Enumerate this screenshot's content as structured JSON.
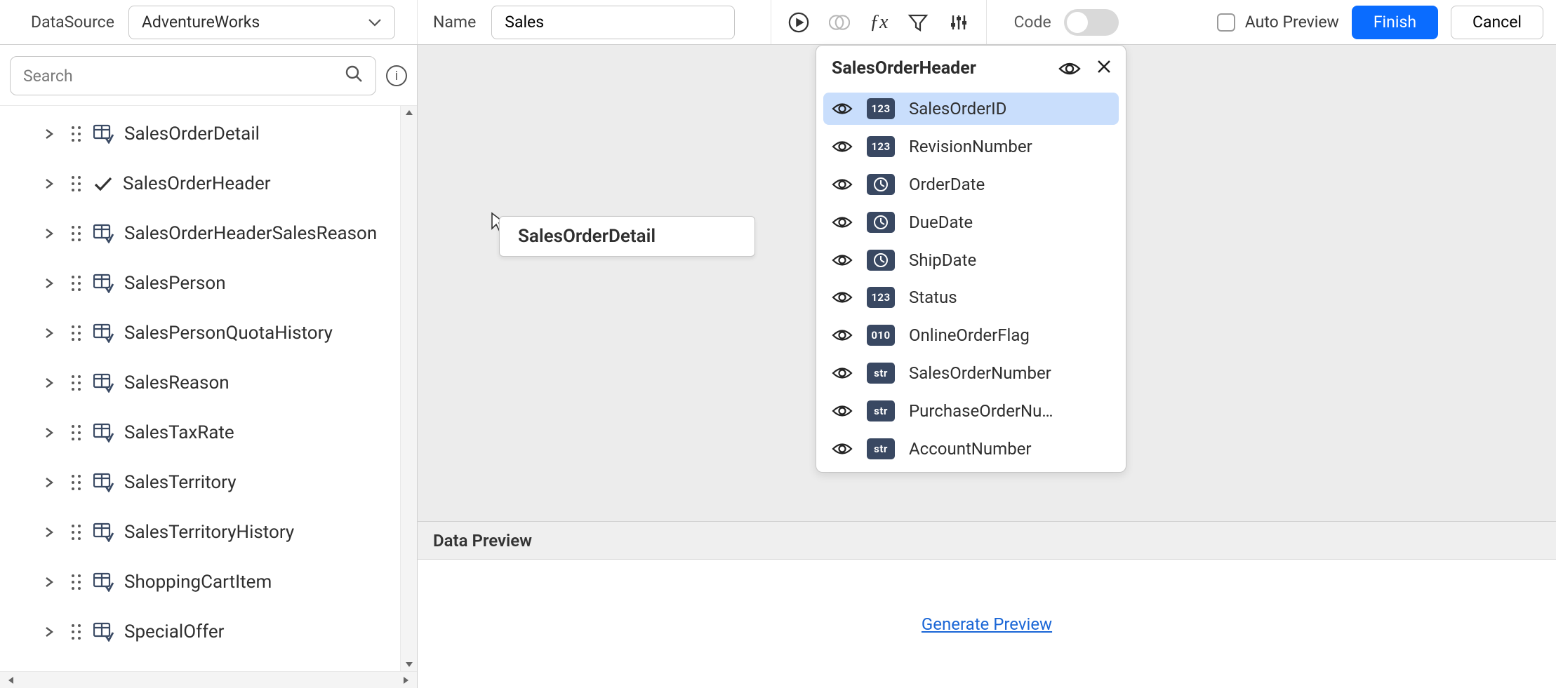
{
  "topbar": {
    "datasource_label": "DataSource",
    "datasource_value": "AdventureWorks",
    "name_label": "Name",
    "name_value": "Sales",
    "code_label": "Code",
    "auto_preview_label": "Auto Preview",
    "finish_label": "Finish",
    "cancel_label": "Cancel"
  },
  "sidebar": {
    "search_placeholder": "Search",
    "items": [
      {
        "label": "SalesOrderDetail",
        "checked": false
      },
      {
        "label": "SalesOrderHeader",
        "checked": true
      },
      {
        "label": "SalesOrderHeaderSalesReason",
        "checked": false
      },
      {
        "label": "SalesPerson",
        "checked": false
      },
      {
        "label": "SalesPersonQuotaHistory",
        "checked": false
      },
      {
        "label": "SalesReason",
        "checked": false
      },
      {
        "label": "SalesTaxRate",
        "checked": false
      },
      {
        "label": "SalesTerritory",
        "checked": false
      },
      {
        "label": "SalesTerritoryHistory",
        "checked": false
      },
      {
        "label": "ShoppingCartItem",
        "checked": false
      },
      {
        "label": "SpecialOffer",
        "checked": false
      }
    ]
  },
  "canvas": {
    "drag_card_label": "SalesOrderDetail"
  },
  "field_panel": {
    "title": "SalesOrderHeader",
    "fields": [
      {
        "type": "123",
        "label": "SalesOrderID",
        "selected": true
      },
      {
        "type": "123",
        "label": "RevisionNumber",
        "selected": false
      },
      {
        "type": "clock",
        "label": "OrderDate",
        "selected": false
      },
      {
        "type": "clock",
        "label": "DueDate",
        "selected": false
      },
      {
        "type": "clock",
        "label": "ShipDate",
        "selected": false
      },
      {
        "type": "123",
        "label": "Status",
        "selected": false
      },
      {
        "type": "010",
        "label": "OnlineOrderFlag",
        "selected": false
      },
      {
        "type": "str",
        "label": "SalesOrderNumber",
        "selected": false
      },
      {
        "type": "str",
        "label": "PurchaseOrderNu…",
        "selected": false
      },
      {
        "type": "str",
        "label": "AccountNumber",
        "selected": false
      }
    ]
  },
  "preview": {
    "title": "Data Preview",
    "link_label": "Generate Preview"
  }
}
